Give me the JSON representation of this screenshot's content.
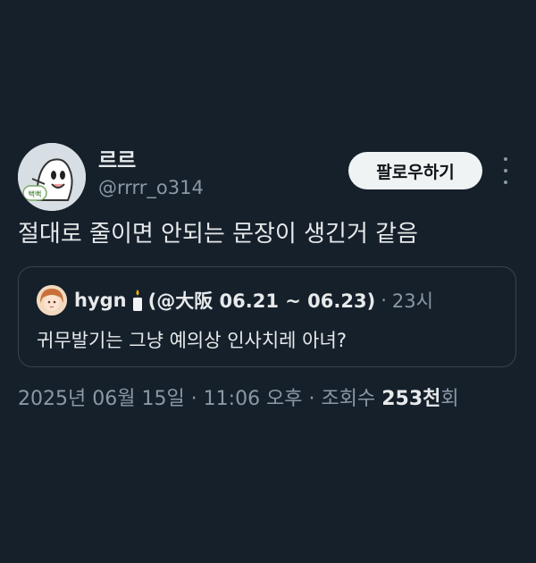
{
  "tweet": {
    "author": {
      "display_name": "르르",
      "handle": "@rrrr_o314",
      "avatar_badge": "뻑뻑"
    },
    "follow_label": "팔로우하기",
    "more_icon": "more-vertical-icon",
    "text": "절대로 줄이면 안되는 문장이 생긴거 같음",
    "quote": {
      "name": "hygn",
      "name_icon": "candle-icon",
      "name_rest": "(@大阪 06.21 ~ 06.23)",
      "separator": "·",
      "time": "23시",
      "text": "귀무발기는 그냥 예의상 인사치레 아녀?"
    },
    "meta": {
      "datetime": "2025년 06월 15일 · 11:06 오후 · 조회수 ",
      "views": "253천",
      "views_suffix": "회"
    }
  },
  "colors": {
    "background": "#15202b",
    "primary_text": "#e7e9ea",
    "secondary_text": "#8b98a5",
    "border": "#38444d",
    "button_bg": "#eff3f4"
  }
}
